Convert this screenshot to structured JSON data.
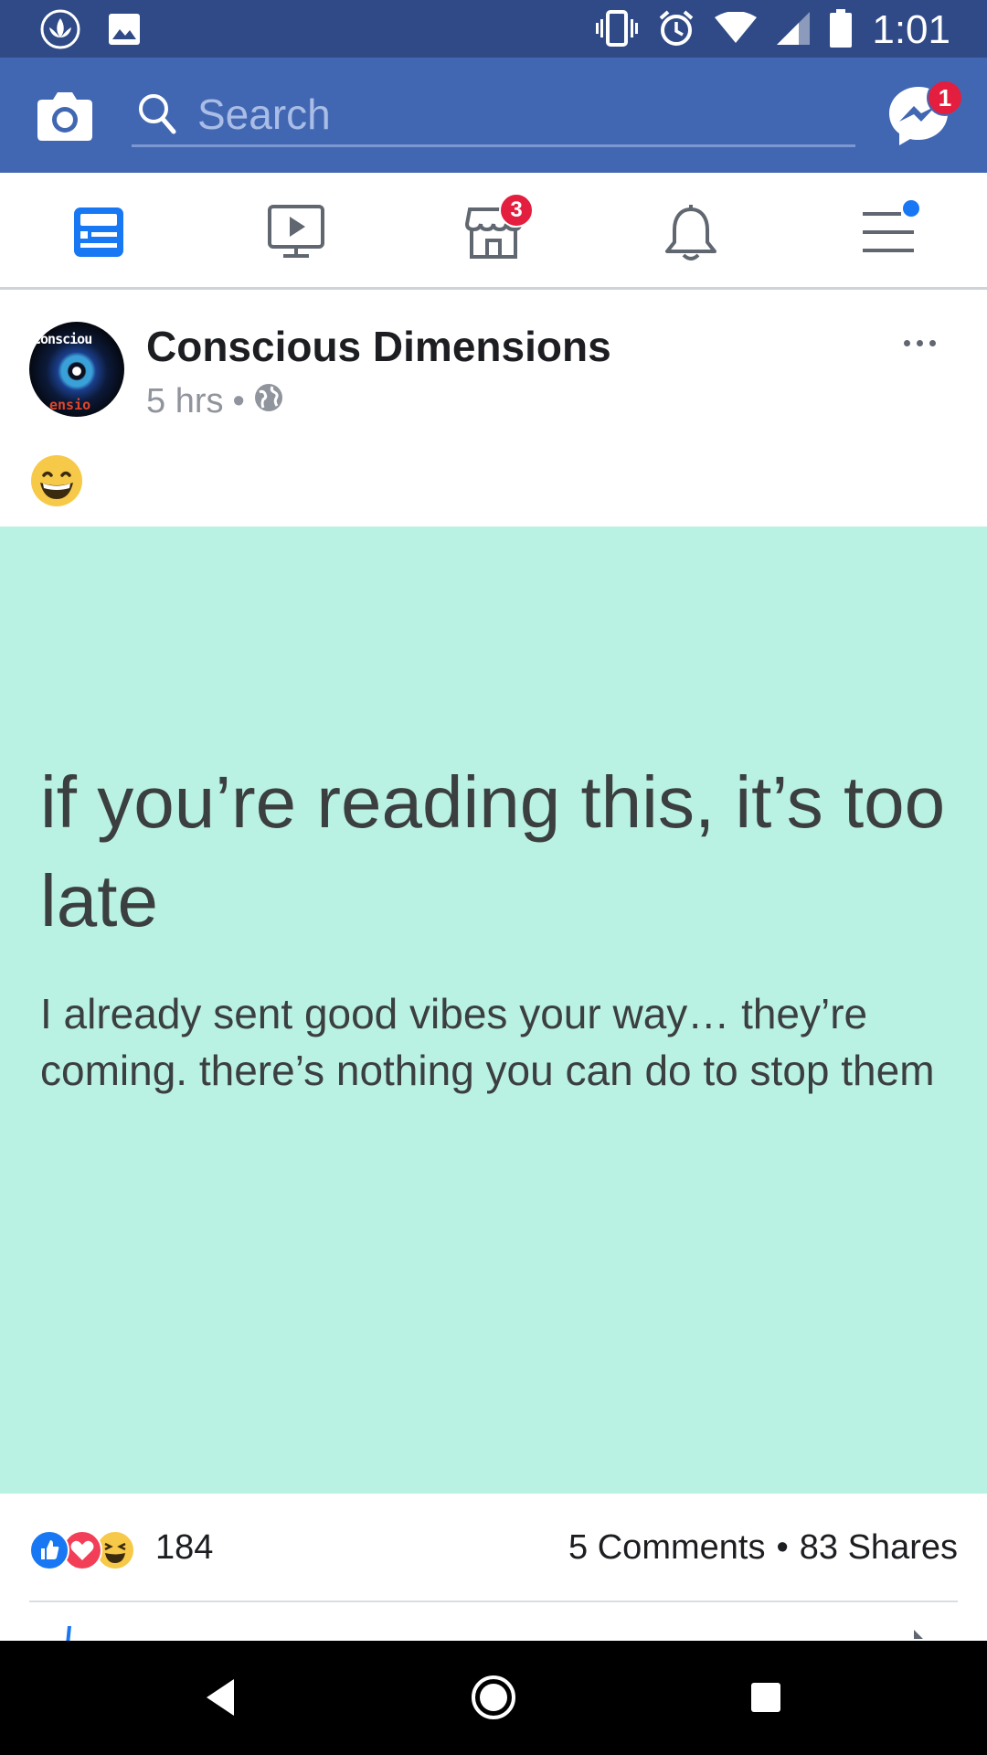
{
  "status_bar": {
    "time": "1:01",
    "left_icons": [
      "lotus-icon",
      "image-icon"
    ],
    "right_icons": [
      "vibrate-icon",
      "alarm-icon",
      "wifi-icon",
      "signal-icon",
      "battery-icon"
    ]
  },
  "header": {
    "search_placeholder": "Search",
    "messenger_badge": "1",
    "colors": {
      "bar": "#4267b2",
      "status": "#2f4a86"
    }
  },
  "tabs": [
    {
      "name": "news-feed",
      "active": true
    },
    {
      "name": "watch"
    },
    {
      "name": "marketplace",
      "badge": "3"
    },
    {
      "name": "notifications"
    },
    {
      "name": "menu",
      "dot": true
    }
  ],
  "post": {
    "page_name": "Conscious Dimensions",
    "time": "5 hrs",
    "separator": "•",
    "avatar_text_top": "Consciou",
    "avatar_text_bottom": "ensio",
    "emoji": "grinning-face",
    "image": {
      "headline": "if you’re reading this, it’s too late",
      "body": "I already sent good vibes your way… they’re coming. there’s nothing you can do to stop them",
      "background": "#b9f1e2"
    },
    "reaction_count": "184",
    "comments": "5 Comments",
    "shares": "83 Shares",
    "dot": "•"
  }
}
